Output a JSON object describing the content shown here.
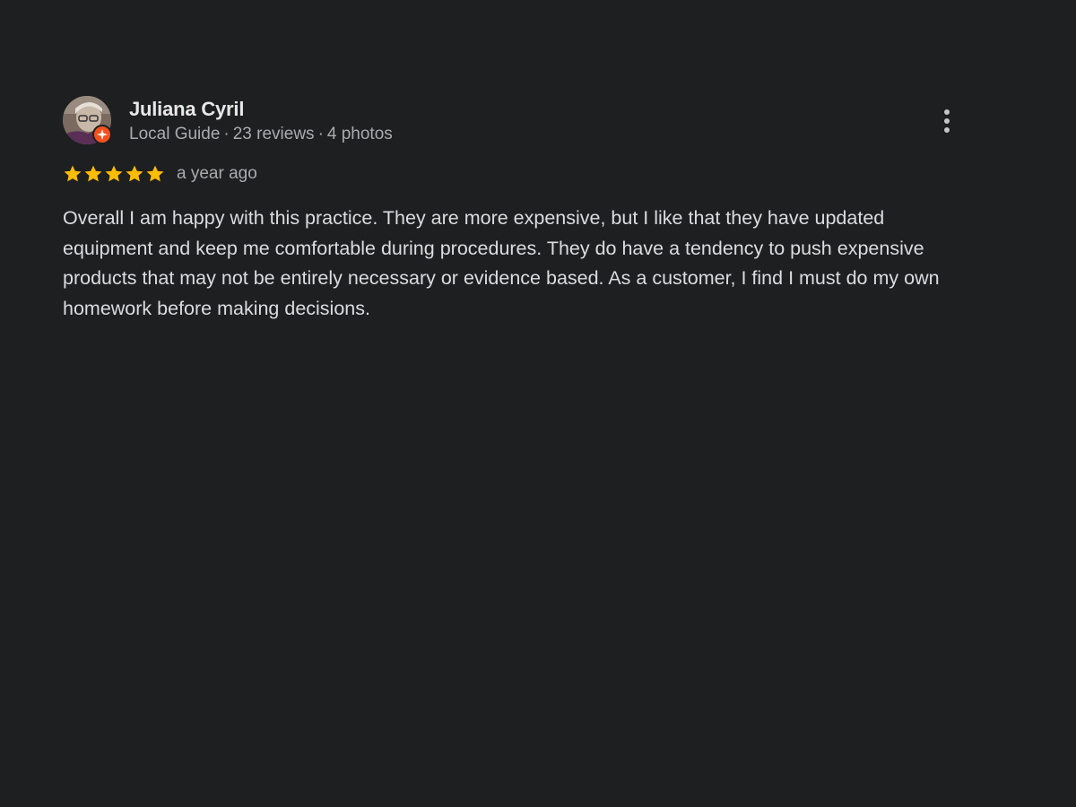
{
  "review": {
    "author": "Juliana Cyril",
    "badge": "Local Guide",
    "reviews_count": "23 reviews",
    "photos_count": "4 photos",
    "separator": "·",
    "rating": 5,
    "rating_max": 5,
    "date": "a year ago",
    "text": "Overall I am happy with this practice. They are more expensive, but I like that they have updated equipment and keep me comfortable during procedures. They do have a tendency to push expensive products that may not be entirely necessary or evidence based. As a customer, I find I must do my own homework before making decisions."
  },
  "icons": {
    "more": "more-vert-icon",
    "star": "star-icon",
    "badge": "local-guide-badge-icon"
  },
  "colors": {
    "background": "#1e1f20",
    "star": "#fbbc04",
    "badge": "#f4511e",
    "secondary_text": "#a9acaf"
  }
}
